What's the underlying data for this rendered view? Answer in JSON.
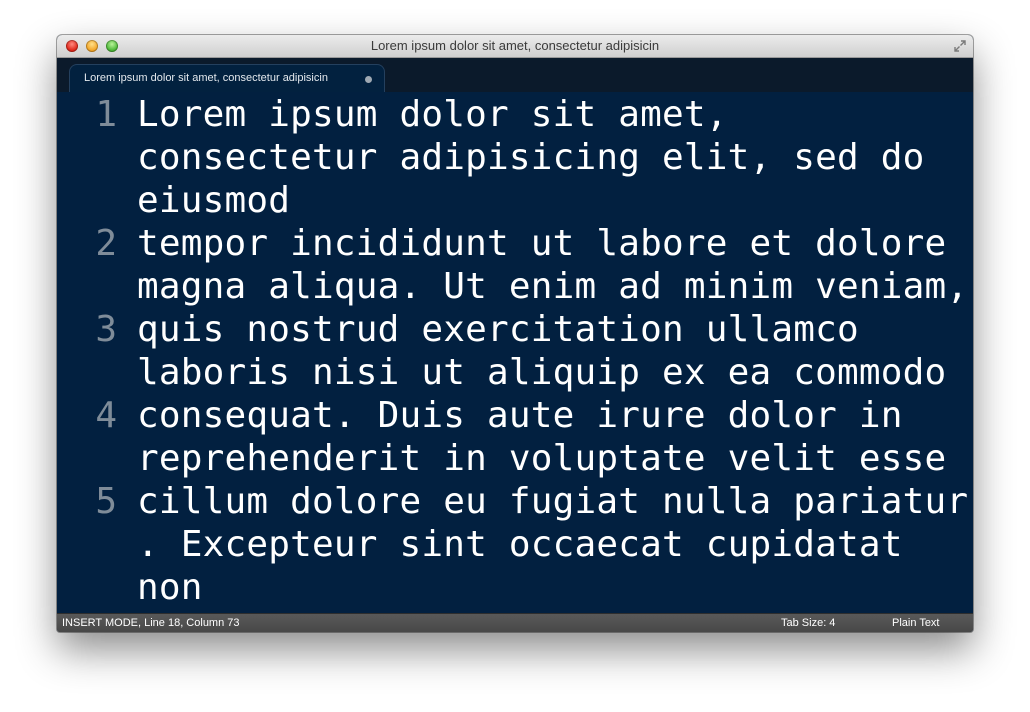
{
  "window": {
    "title": "Lorem ipsum dolor sit amet, consectetur adipisicin"
  },
  "tabs": [
    {
      "label": "Lorem ipsum dolor sit amet, consectetur adipisicin",
      "dirty": true
    }
  ],
  "editor": {
    "lines": [
      {
        "number": "1",
        "wrapped": [
          "Lorem ipsum dolor sit amet,",
          "consectetur adipisicing elit, sed do",
          "eiusmod"
        ]
      },
      {
        "number": "2",
        "wrapped": [
          "tempor incididunt ut labore et dolore",
          "magna aliqua. Ut enim ad minim veniam,"
        ]
      },
      {
        "number": "3",
        "wrapped": [
          "quis nostrud exercitation ullamco",
          "laboris nisi ut aliquip ex ea commodo"
        ]
      },
      {
        "number": "4",
        "wrapped": [
          "consequat. Duis aute irure dolor in",
          "reprehenderit in voluptate velit esse"
        ]
      },
      {
        "number": "5",
        "wrapped": [
          "cillum dolore eu fugiat nulla pariatur",
          ". Excepteur sint occaecat cupidatat",
          "non"
        ]
      }
    ]
  },
  "statusbar": {
    "mode_position": "INSERT MODE, Line 18, Column 73",
    "tab_size": "Tab Size: 4",
    "syntax": "Plain Text"
  },
  "icons": {
    "close": "close-window-icon",
    "minimize": "minimize-window-icon",
    "zoom": "zoom-window-icon",
    "fullscreen": "fullscreen-icon"
  },
  "colors": {
    "editor_background": "#022040",
    "text": "#ffffff",
    "gutter_text": "#7f8c99",
    "statusbar": "#4f4f4f"
  }
}
